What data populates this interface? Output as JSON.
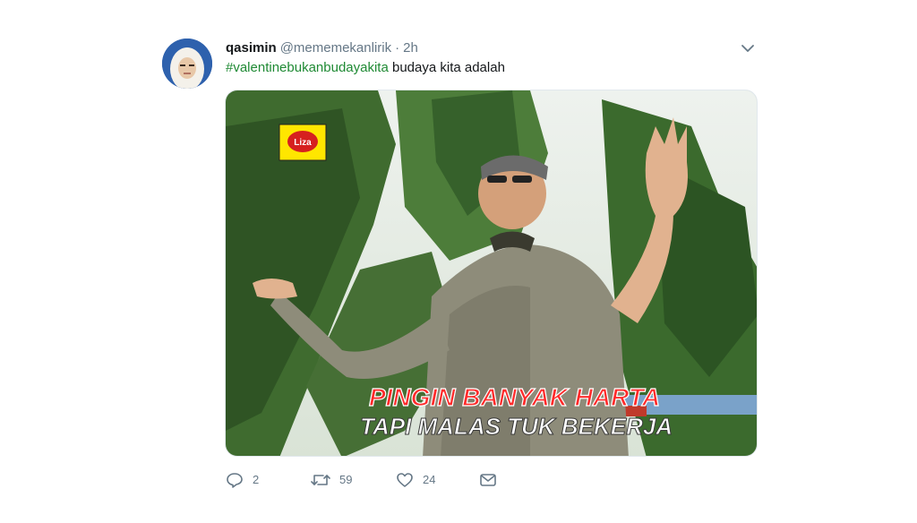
{
  "tweet": {
    "display_name": "qasimin",
    "handle": "@mememekanlirik",
    "separator": "·",
    "time": "2h",
    "hashtag": "#valentinebukanbudayakita",
    "text": " budaya kita adalah",
    "media": {
      "caption_line1": "PINGIN BANYAK HARTA",
      "caption_line2": "TAPI MALAS TUK BEKERJA",
      "channel_logo": "Liza"
    },
    "actions": {
      "replies": "2",
      "retweets": "59",
      "likes": "24"
    }
  },
  "icons": {
    "reply": "reply-icon",
    "retweet": "retweet-icon",
    "like": "heart-icon",
    "message": "envelope-icon",
    "menu": "chevron-down-icon"
  },
  "colors": {
    "hashtag": "#1f8a34",
    "secondary_text": "#657786",
    "caption_fill": "#ff2a2a",
    "caption_fill2": "#ffffff"
  }
}
